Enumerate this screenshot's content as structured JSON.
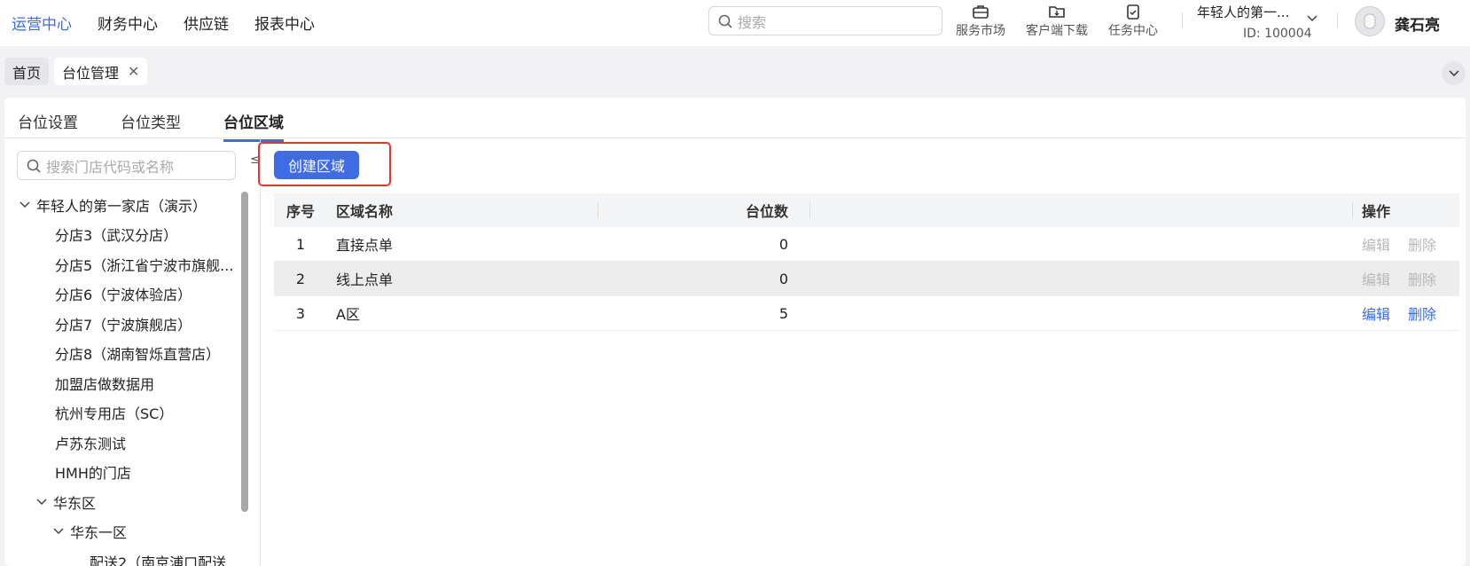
{
  "nav": {
    "menu": [
      {
        "label": "运营中心",
        "active": true
      },
      {
        "label": "财务中心",
        "active": false
      },
      {
        "label": "供应链",
        "active": false
      },
      {
        "label": "报表中心",
        "active": false
      }
    ],
    "search_placeholder": "搜索",
    "tools": [
      {
        "label": "服务市场",
        "icon": "briefcase-icon"
      },
      {
        "label": "客户端下载",
        "icon": "folder-download-icon"
      },
      {
        "label": "任务中心",
        "icon": "clipboard-check-icon"
      }
    ],
    "org_name": "年轻人的第一...",
    "org_id": "ID: 100004",
    "user_name": "龚石亮"
  },
  "page_tabs": [
    {
      "label": "首页",
      "closable": false,
      "active": false
    },
    {
      "label": "台位管理",
      "closable": true,
      "active": true
    }
  ],
  "sub_tabs": [
    {
      "label": "台位设置",
      "active": false
    },
    {
      "label": "台位类型",
      "active": false
    },
    {
      "label": "台位区域",
      "active": true
    }
  ],
  "sidebar": {
    "search_placeholder": "搜索门店代码或名称",
    "collapse_label": "≤",
    "tree": [
      {
        "label": "年轻人的第一家店（演示）",
        "level": 0,
        "expanded": true
      },
      {
        "label": "分店3（武汉分店）",
        "level": 1
      },
      {
        "label": "分店5（浙江省宁波市旗舰...",
        "level": 1
      },
      {
        "label": "分店6（宁波体验店）",
        "level": 1
      },
      {
        "label": "分店7（宁波旗舰店）",
        "level": 1
      },
      {
        "label": "分店8（湖南智烁直营店）",
        "level": 1
      },
      {
        "label": "加盟店做数据用",
        "level": 1
      },
      {
        "label": "杭州专用店（SC）",
        "level": 1
      },
      {
        "label": "卢苏东测试",
        "level": 1
      },
      {
        "label": "HMH的门店",
        "level": 1
      },
      {
        "label": "华东区",
        "level": 1,
        "expanded": true
      },
      {
        "label": "华东一区",
        "level": 2,
        "expanded": true
      },
      {
        "label": "配送2（南京浦口配送",
        "level": 3
      }
    ]
  },
  "toolbar": {
    "create_label": "创建区域"
  },
  "table": {
    "headers": {
      "no": "序号",
      "name": "区域名称",
      "count": "台位数",
      "ops": "操作"
    },
    "rows": [
      {
        "no": "1",
        "name": "直接点单",
        "count": "0",
        "edit": "编辑",
        "delete": "删除",
        "enabled": false
      },
      {
        "no": "2",
        "name": "线上点单",
        "count": "0",
        "edit": "编辑",
        "delete": "删除",
        "enabled": false
      },
      {
        "no": "3",
        "name": "A区",
        "count": "5",
        "edit": "编辑",
        "delete": "删除",
        "enabled": true
      }
    ]
  },
  "colors": {
    "accent": "#3a6de6",
    "button": "#3f6ce4",
    "highlight": "#e5382d"
  }
}
